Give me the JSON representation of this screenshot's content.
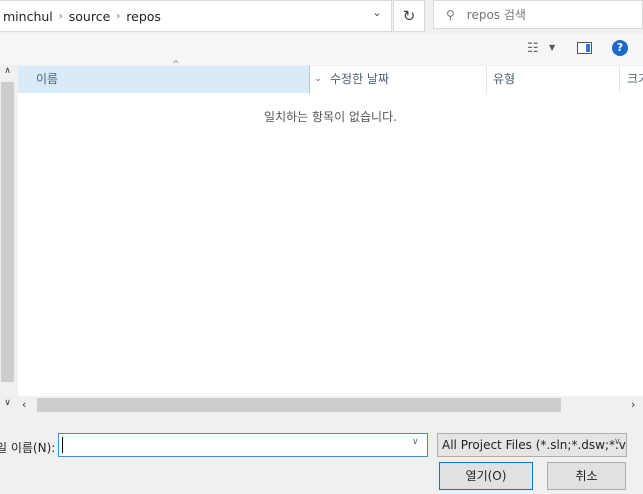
{
  "address": {
    "crumbs": [
      "minchul",
      "source",
      "repos"
    ]
  },
  "search": {
    "placeholder": "repos 검색"
  },
  "icons": {
    "refresh": "↻",
    "search": "⚲",
    "view": "☷",
    "help": "?"
  },
  "columns": {
    "name": "이름",
    "date": "수정한 날짜",
    "type": "유형",
    "size": "크기"
  },
  "list": {
    "empty_message": "일치하는 항목이 없습니다."
  },
  "footer": {
    "filename_label": "일 이름(N):",
    "filename_value": "",
    "filter": "All Project Files (*.sln;*.dsw;*.vc",
    "open": "열기(O)",
    "cancel": "취소"
  }
}
